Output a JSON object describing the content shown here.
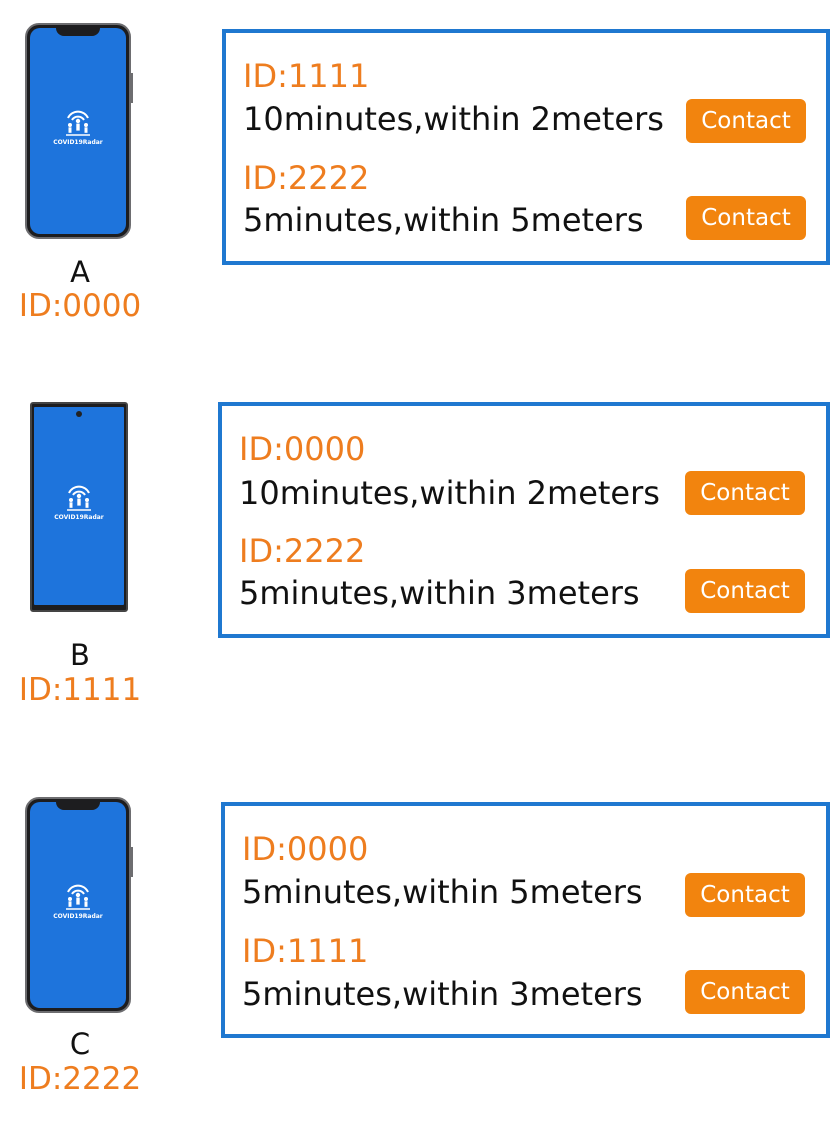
{
  "colors": {
    "accent_orange": "#ee7d1f",
    "button_orange": "#f2840e",
    "panel_border_blue": "#1f78d0",
    "screen_blue": "#1e74dc"
  },
  "app_name": "COVID19Radar",
  "devices": [
    {
      "letter": "A",
      "id_label": "ID:0000",
      "contacts": [
        {
          "id_label": "ID:1111",
          "description": "10minutes,within 2meters",
          "button_label": "Contact"
        },
        {
          "id_label": "ID:2222",
          "description": "5minutes,within 5meters",
          "button_label": "Contact"
        }
      ]
    },
    {
      "letter": "B",
      "id_label": "ID:1111",
      "contacts": [
        {
          "id_label": "ID:0000",
          "description": "10minutes,within 2meters",
          "button_label": "Contact"
        },
        {
          "id_label": "ID:2222",
          "description": "5minutes,within 3meters",
          "button_label": "Contact"
        }
      ]
    },
    {
      "letter": "C",
      "id_label": "ID:2222",
      "contacts": [
        {
          "id_label": "ID:0000",
          "description": "5minutes,within 5meters",
          "button_label": "Contact"
        },
        {
          "id_label": "ID:1111",
          "description": "5minutes,within 3meters",
          "button_label": "Contact"
        }
      ]
    }
  ]
}
